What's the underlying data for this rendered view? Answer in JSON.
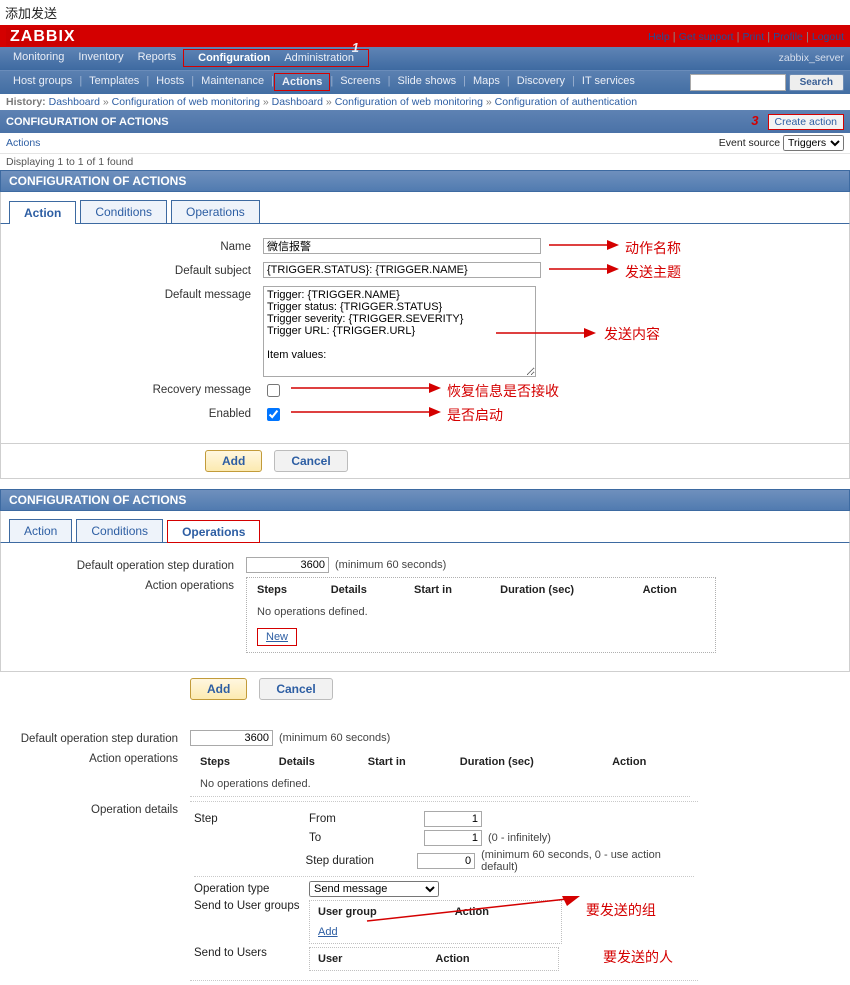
{
  "page_title": "添加发送",
  "logo": "ZABBIX",
  "top_links": [
    "Help",
    "Get support",
    "Print",
    "Profile",
    "Logout"
  ],
  "server_name": "zabbix_server",
  "nav1": [
    "Monitoring",
    "Inventory",
    "Reports",
    "Configuration",
    "Administration"
  ],
  "nav2": [
    "Host groups",
    "Templates",
    "Hosts",
    "Maintenance",
    "Actions",
    "Screens",
    "Slide shows",
    "Maps",
    "Discovery",
    "IT services"
  ],
  "num1": "1",
  "num3": "3",
  "search_btn": "Search",
  "history_label": "History:",
  "history": [
    "Dashboard",
    "Configuration of web monitoring",
    "Dashboard",
    "Configuration of web monitoring",
    "Configuration of authentication"
  ],
  "section_title": "CONFIGURATION OF ACTIONS",
  "create_action": "Create action",
  "actions_link": "Actions",
  "event_src_label": "Event source",
  "event_src_value": "Triggers",
  "count_text": "Displaying 1 to 1 of 1 found",
  "tabs": {
    "action": "Action",
    "conditions": "Conditions",
    "operations": "Operations"
  },
  "panel1": {
    "name_label": "Name",
    "name_value": "微信报警",
    "subject_label": "Default subject",
    "subject_value": "{TRIGGER.STATUS}: {TRIGGER.NAME}",
    "message_label": "Default message",
    "message_value": "Trigger: {TRIGGER.NAME}\nTrigger status: {TRIGGER.STATUS}\nTrigger severity: {TRIGGER.SEVERITY}\nTrigger URL: {TRIGGER.URL}\n\nItem values:",
    "recovery_label": "Recovery message",
    "enabled_label": "Enabled",
    "add_btn": "Add",
    "cancel_btn": "Cancel",
    "note_name": "动作名称",
    "note_subject": "发送主题",
    "note_message": "发送内容",
    "note_recovery": "恢复信息是否接收",
    "note_enabled": "是否启动"
  },
  "panel2": {
    "dur_label": "Default operation step duration",
    "dur_value": "3600",
    "dur_hint": "(minimum 60 seconds)",
    "ops_label": "Action operations",
    "th": [
      "Steps",
      "Details",
      "Start in",
      "Duration (sec)",
      "Action"
    ],
    "no_ops": "No operations defined.",
    "new_link": "New",
    "add_btn": "Add",
    "cancel_btn": "Cancel"
  },
  "panel3": {
    "dur_label": "Default operation step duration",
    "dur_value": "3600",
    "dur_hint": "(minimum 60 seconds)",
    "ops_label": "Action operations",
    "th": [
      "Steps",
      "Details",
      "Start in",
      "Duration (sec)",
      "Action"
    ],
    "no_ops": "No operations defined.",
    "opdetails_label": "Operation details",
    "step_label": "Step",
    "from_label": "From",
    "from_val": "1",
    "to_label": "To",
    "to_val": "1",
    "to_hint": "(0 - infinitely)",
    "stepdur_label": "Step duration",
    "stepdur_val": "0",
    "stepdur_hint": "(minimum 60 seconds, 0 - use action default)",
    "optype_label": "Operation type",
    "optype_val": "Send message",
    "sendgrp_label": "Send to User groups",
    "usergrp_th": [
      "User group",
      "Action"
    ],
    "add_link": "Add",
    "sendusr_label": "Send to Users",
    "user_th": [
      "User",
      "Action"
    ],
    "note_grp": "要发送的组",
    "note_usr": "要发送的人"
  }
}
